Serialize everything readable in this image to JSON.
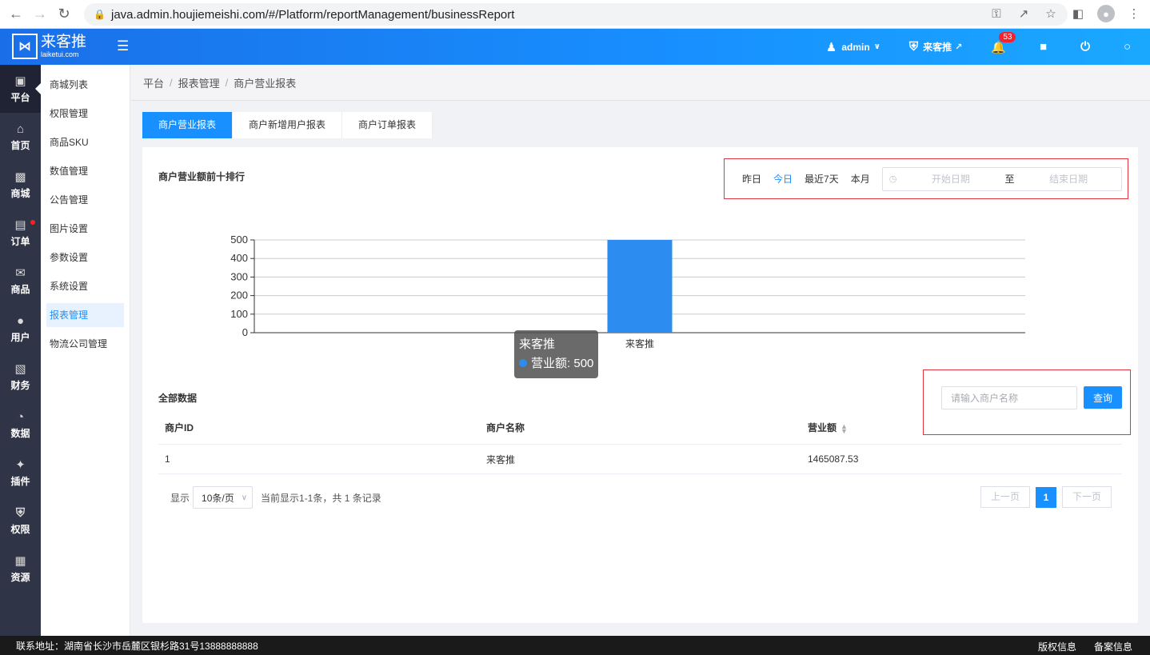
{
  "browser": {
    "url": "java.admin.houjiemeishi.com/#/Platform/reportManagement/businessReport"
  },
  "topbar": {
    "logo_text": "来客推",
    "logo_sub": "laiketui.com",
    "user": "admin",
    "store": "来客推",
    "notification_count": "53"
  },
  "leftnav": [
    {
      "label": "平台",
      "icon": "platform-icon",
      "active": true
    },
    {
      "label": "首页",
      "icon": "home-icon"
    },
    {
      "label": "商城",
      "icon": "mall-icon"
    },
    {
      "label": "订单",
      "icon": "order-icon",
      "dot": true
    },
    {
      "label": "商品",
      "icon": "goods-icon"
    },
    {
      "label": "用户",
      "icon": "user-icon"
    },
    {
      "label": "财务",
      "icon": "finance-icon"
    },
    {
      "label": "数据",
      "icon": "data-icon"
    },
    {
      "label": "插件",
      "icon": "plugin-icon"
    },
    {
      "label": "权限",
      "icon": "permission-icon"
    },
    {
      "label": "资源",
      "icon": "resource-icon"
    }
  ],
  "submenu": [
    "商城列表",
    "权限管理",
    "商品SKU",
    "数值管理",
    "公告管理",
    "图片设置",
    "参数设置",
    "系统设置",
    "报表管理",
    "物流公司管理"
  ],
  "submenu_active": "报表管理",
  "breadcrumb": [
    "平台",
    "报表管理",
    "商户营业报表"
  ],
  "tabs": [
    "商户营业报表",
    "商户新增用户报表",
    "商户订单报表"
  ],
  "chart_section": {
    "title": "商户营业额前十排行",
    "date_options": [
      "昨日",
      "今日",
      "最近7天",
      "本月"
    ],
    "date_active": "今日",
    "start_placeholder": "开始日期",
    "to_label": "至",
    "end_placeholder": "结束日期"
  },
  "chart_data": {
    "type": "bar",
    "categories": [
      "来客推"
    ],
    "series": [
      {
        "name": "营业额",
        "values": [
          500
        ]
      }
    ],
    "ylim": [
      0,
      500
    ],
    "yticks": [
      0,
      100,
      200,
      300,
      400,
      500
    ],
    "tooltip": {
      "title": "来客推",
      "series": "营业额",
      "value": "500"
    },
    "bar_color": "#2d8cf0"
  },
  "table_section": {
    "title": "全部数据",
    "search_placeholder": "请输入商户名称",
    "search_button": "查询",
    "columns": [
      "商户ID",
      "商户名称",
      "营业额"
    ],
    "rows": [
      [
        "1",
        "来客推",
        "1465087.53"
      ]
    ]
  },
  "pagination": {
    "show_label": "显示",
    "page_size": "10条/页",
    "summary": "当前显示1-1条，共 1 条记录",
    "prev": "上一页",
    "current": "1",
    "next": "下一页"
  },
  "footer": {
    "address": "联系地址：湖南省长沙市岳麓区银杉路31号13888888888",
    "links": [
      "版权信息",
      "备案信息"
    ]
  }
}
